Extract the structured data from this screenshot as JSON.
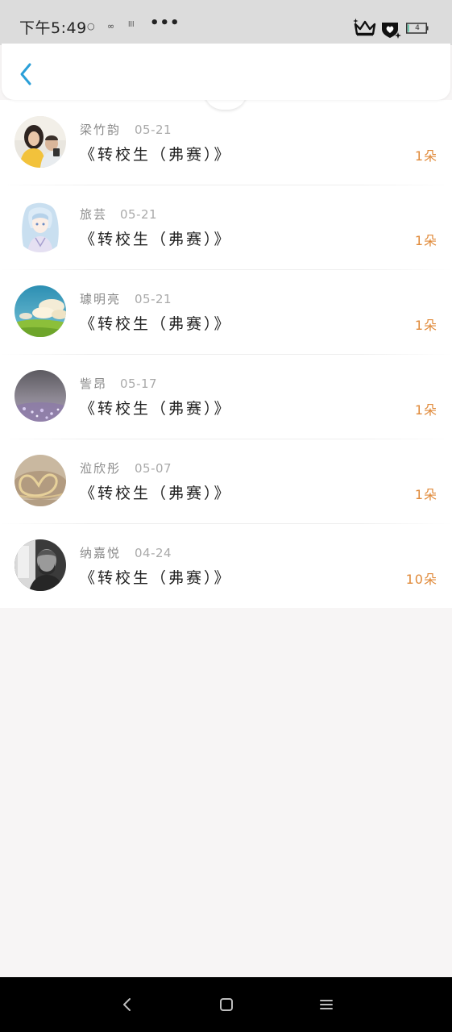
{
  "status_bar": {
    "time": "下午5:49",
    "icon_1": "○",
    "icon_2": "∞",
    "icon_3": "lll",
    "more": "•••",
    "battery_level": "4"
  },
  "header": {
    "back_icon": "chevron-left-icon"
  },
  "gifts": [
    {
      "user": "梁竹韵",
      "date": "05-21",
      "title": "《转校生（弗赛）》",
      "count": "1朵",
      "avatar": "couple-photo"
    },
    {
      "user": "旅芸",
      "date": "05-21",
      "title": "《转校生（弗赛）》",
      "count": "1朵",
      "avatar": "anime-girl"
    },
    {
      "user": "璩明亮",
      "date": "05-21",
      "title": "《转校生（弗赛）》",
      "count": "1朵",
      "avatar": "sky-landscape"
    },
    {
      "user": "訾昂",
      "date": "05-17",
      "title": "《转校生（弗赛）》",
      "count": "1朵",
      "avatar": "purple-bokeh"
    },
    {
      "user": "涖欣彤",
      "date": "05-07",
      "title": "《转校生（弗赛）》",
      "count": "1朵",
      "avatar": "heart-bracelet"
    },
    {
      "user": "纳嘉悦",
      "date": "04-24",
      "title": "《转校生（弗赛）》",
      "count": "10朵",
      "avatar": "bw-portrait"
    }
  ],
  "colors": {
    "accent_blue": "#2a9fd8",
    "count_orange": "#e08a3a",
    "background": "#f7f5f5"
  },
  "nav": {
    "back": "nav-back-icon",
    "home": "nav-home-icon",
    "menu": "nav-menu-icon"
  }
}
